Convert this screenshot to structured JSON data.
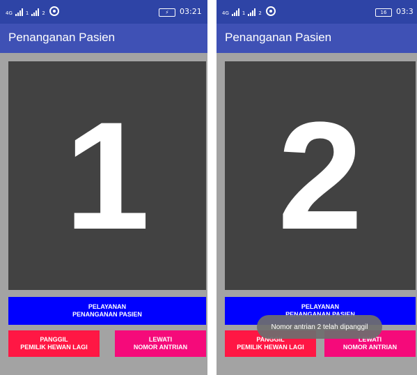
{
  "left": {
    "status": {
      "network": "4G",
      "sub1": "1",
      "sub2": "2",
      "battery": "⚡",
      "time": "03:21"
    },
    "app_title": "Penanganan Pasien",
    "queue_number": "1",
    "buttons": {
      "service": "PELAYANAN\nPENANGANAN PASIEN",
      "call_again": "PANGGIL\nPEMILIK HEWAN LAGI",
      "skip": "LEWATI\nNOMOR ANTRIAN"
    }
  },
  "right": {
    "status": {
      "network": "4G",
      "sub1": "1",
      "sub2": "2",
      "battery": "16",
      "time": "03:3"
    },
    "app_title": "Penanganan Pasien",
    "queue_number": "2",
    "buttons": {
      "service": "PELAYANAN\nPENANGANAN PASIEN",
      "call_again": "PANGGIL\nPEMILIK HEWAN LAGI",
      "skip": "LEWATI\nNOMOR ANTRIAN"
    },
    "toast": "Nomor antrian 2 telah dipanggil"
  }
}
